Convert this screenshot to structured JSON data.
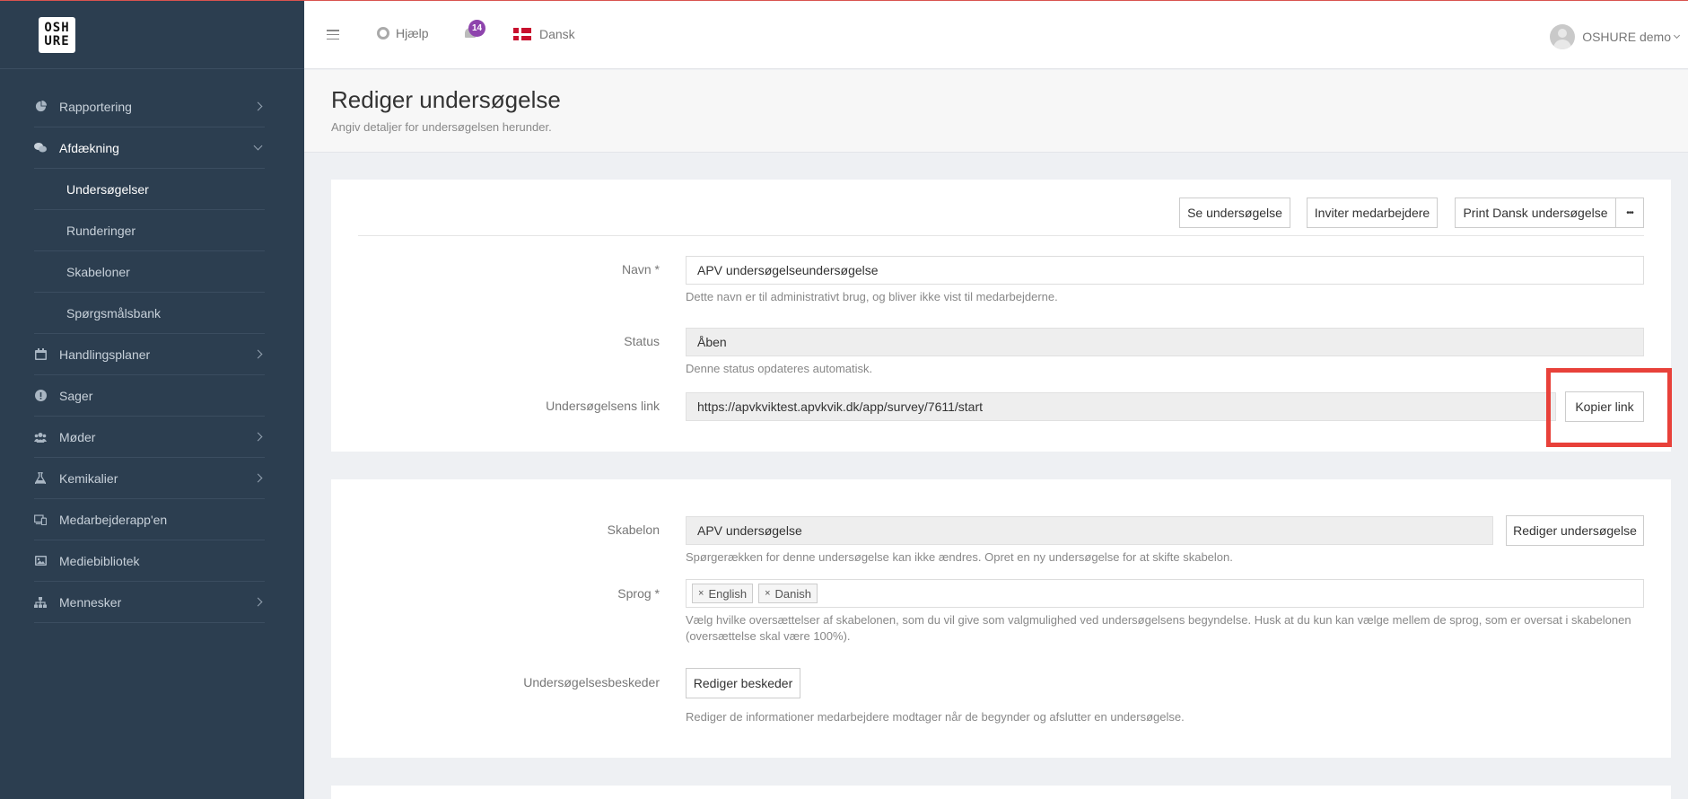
{
  "logo": {
    "line1": "OSH",
    "line2": "URE"
  },
  "sidebar": {
    "items": [
      {
        "label": "Rapportering",
        "icon": "pie-chart-icon"
      },
      {
        "label": "Afdækning",
        "icon": "chat-bubbles-icon"
      },
      {
        "label": "Undersøgelser"
      },
      {
        "label": "Runderinger"
      },
      {
        "label": "Skabeloner"
      },
      {
        "label": "Spørgsmålsbank"
      },
      {
        "label": "Handlingsplaner",
        "icon": "calendar-icon"
      },
      {
        "label": "Sager",
        "icon": "alert-circle-icon"
      },
      {
        "label": "Møder",
        "icon": "users-icon"
      },
      {
        "label": "Kemikalier",
        "icon": "flask-icon"
      },
      {
        "label": "Medarbejderapp'en",
        "icon": "devices-icon"
      },
      {
        "label": "Mediebibliotek",
        "icon": "image-icon"
      },
      {
        "label": "Mennesker",
        "icon": "org-chart-icon"
      }
    ]
  },
  "header": {
    "help_label": "Hjælp",
    "notifications_count": "14",
    "language_label": "Dansk",
    "user_label": "OSHURE demo"
  },
  "page": {
    "title": "Rediger undersøgelse",
    "subtitle": "Angiv detaljer for undersøgelsen herunder."
  },
  "actions": {
    "view": "Se undersøgelse",
    "invite": "Inviter medarbejdere",
    "print": "Print Dansk undersøgelse",
    "more": "•••"
  },
  "form": {
    "name_label": "Navn *",
    "name_value": "APV undersøgelseundersøgelse",
    "name_help": "Dette navn er til administrativt brug, og bliver ikke vist til medarbejderne.",
    "status_label": "Status",
    "status_value": "Åben",
    "status_help": "Denne status opdateres automatisk.",
    "link_label": "Undersøgelsens link",
    "link_value": "https://apvkviktest.apvkvik.dk/app/survey/7611/start",
    "copy_link": "Kopier link",
    "template_label": "Skabelon",
    "template_value": "APV undersøgelse",
    "edit_survey": "Rediger undersøgelse",
    "template_help": "Spørgerækken for denne undersøgelse kan ikke ændres. Opret en ny undersøgelse for at skifte skabelon.",
    "language_label": "Sprog *",
    "languages": [
      "English",
      "Danish"
    ],
    "remove_symbol": "×",
    "language_help": "Vælg hvilke oversættelser af skabelonen, som du vil give som valgmulighed ved undersøgelsens begyndelse. Husk at du kun kan vælge mellem de sprog, som er oversat i skabelonen (oversættelse skal være 100%).",
    "messages_label": "Undersøgelsesbeskeder",
    "edit_messages": "Rediger beskeder",
    "messages_help": "Rediger de informationer medarbejdere modtager når de begynder og afslutter en undersøgelse."
  },
  "colors": {
    "sidebar_bg": "#2c3e50",
    "badge": "#8e44ad",
    "highlight": "#e8413a"
  }
}
